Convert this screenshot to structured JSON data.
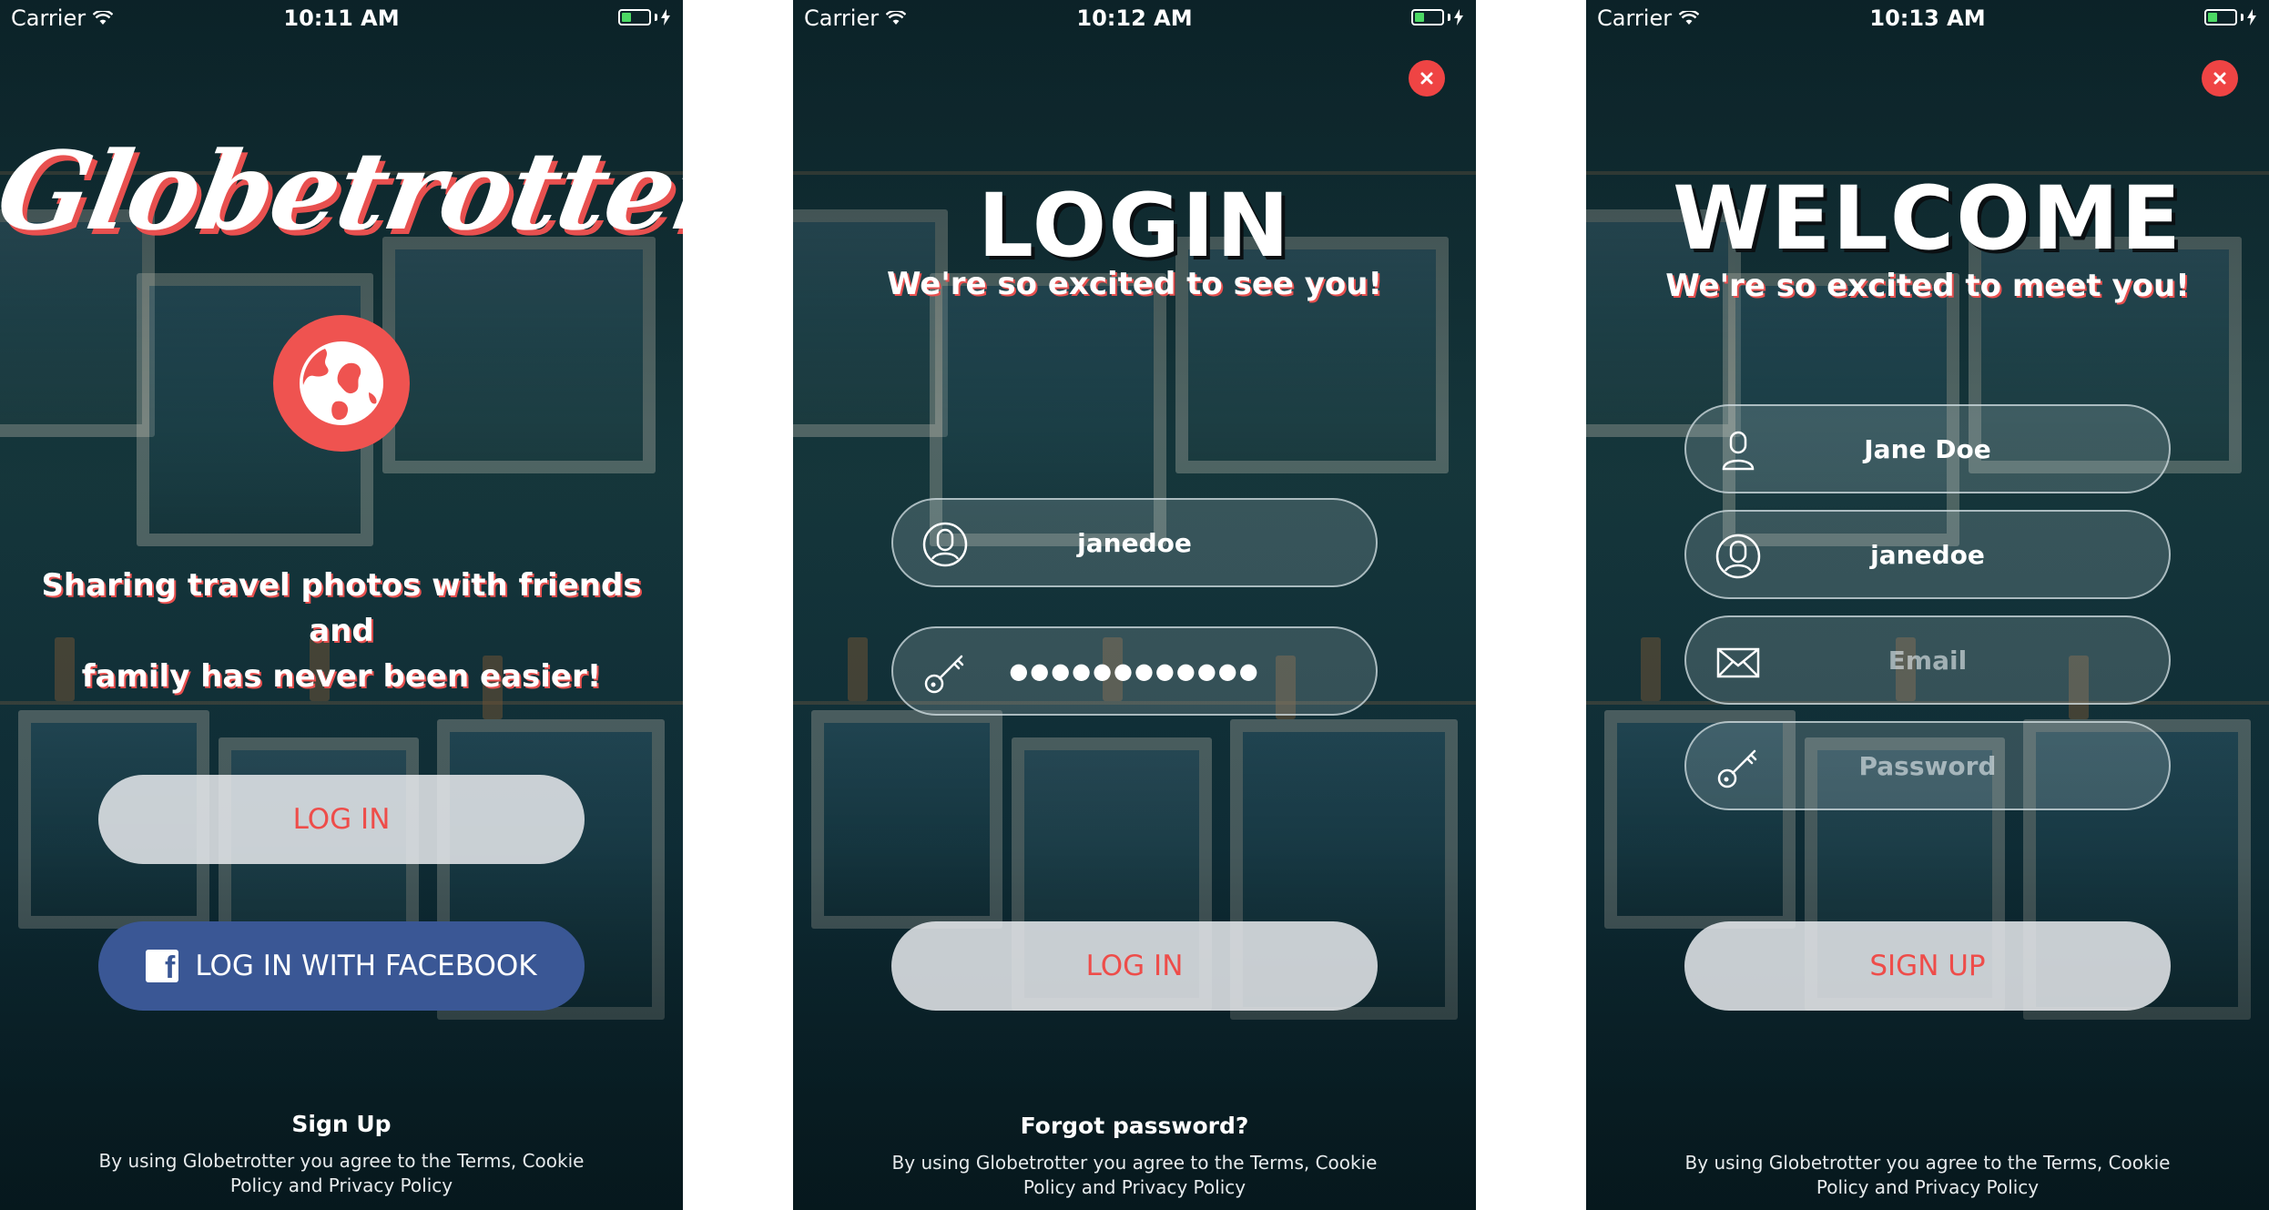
{
  "colors": {
    "accent": "#ef5350",
    "facebook": "#3a5795",
    "light_button_bg": "#e6e9ec",
    "light_button_text": "#ee4d4a"
  },
  "screens": [
    {
      "status": {
        "carrier": "Carrier",
        "time": "10:11 AM"
      },
      "logo": "Globetrotter",
      "tagline_line1": "Sharing travel photos with friends and",
      "tagline_line2": "family has never been easier!",
      "login_button": "LOG IN",
      "facebook_button": "LOG IN WITH FACEBOOK",
      "footer_link": "Sign Up",
      "legal_line1": "By using Globetrotter you agree to the Terms, Cookie",
      "legal_line2": "Policy and Privacy Policy"
    },
    {
      "status": {
        "carrier": "Carrier",
        "time": "10:12 AM"
      },
      "title": "LOGIN",
      "subtitle": "We're so excited to see you!",
      "username_value": "janedoe",
      "password_value": "●●●●●●●●●●●●",
      "login_button": "LOG IN",
      "footer_link": "Forgot password?",
      "legal_line1": "By using Globetrotter you agree to the Terms, Cookie",
      "legal_line2": "Policy and Privacy Policy"
    },
    {
      "status": {
        "carrier": "Carrier",
        "time": "10:13 AM"
      },
      "title": "WELCOME",
      "subtitle": "We're so excited to meet you!",
      "name_value": "Jane Doe",
      "username_value": "janedoe",
      "email_placeholder": "Email",
      "password_placeholder": "Password",
      "signup_button": "SIGN UP",
      "legal_line1": "By using Globetrotter you agree to the Terms, Cookie",
      "legal_line2": "Policy and Privacy Policy"
    }
  ],
  "icons": {
    "status": [
      "wifi-icon",
      "battery-icon",
      "charging-icon"
    ],
    "screen1": [
      "globe-icon",
      "facebook-icon"
    ],
    "screen2": [
      "close-icon",
      "user-circle-icon",
      "key-icon"
    ],
    "screen3": [
      "close-icon",
      "person-icon",
      "user-circle-icon",
      "envelope-icon",
      "key-icon"
    ]
  }
}
